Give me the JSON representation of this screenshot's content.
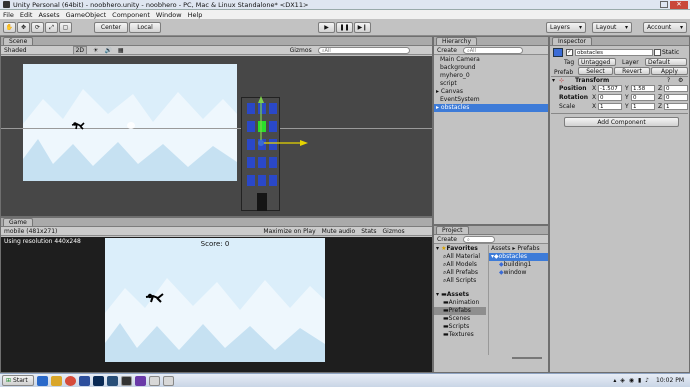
{
  "window": {
    "title": "Unity Personal (64bit) - noobhero.unity - noobhero - PC, Mac & Linux Standalone* <DX11>"
  },
  "menu": [
    "File",
    "Edit",
    "Assets",
    "GameObject",
    "Component",
    "Window",
    "Help"
  ],
  "toolbar": {
    "center": "Center",
    "local": "Local",
    "layers": "Layers",
    "layout": "Layout",
    "account": "Account"
  },
  "scene": {
    "tab": "Scene",
    "shading": "Shaded",
    "mode2d": "2D",
    "gizmos": "Gizmos",
    "search_placeholder": "All"
  },
  "game": {
    "tab": "Game",
    "resolution": "mobile (481x271)",
    "maximize": "Maximize on Play",
    "mute": "Mute audio",
    "stats": "Stats",
    "gizmos": "Gizmos",
    "using_resolution": "Using resolution 440x248",
    "score": "Score: 0"
  },
  "hierarchy": {
    "tab": "Hierarchy",
    "create": "Create",
    "search_placeholder": "All",
    "items": [
      "Main Camera",
      "background",
      "myhero_0",
      "script",
      "Canvas",
      "EventSystem",
      "obstacles"
    ]
  },
  "project": {
    "tab": "Project",
    "create": "Create",
    "favorites": "Favorites",
    "fav_items": [
      "All Material",
      "All Models",
      "All Prefabs",
      "All Scripts"
    ],
    "assets": "Assets",
    "asset_items": [
      "Animation",
      "Prefabs",
      "Scenes",
      "Scripts",
      "Textures"
    ],
    "breadcrumb": "Assets ▸ Prefabs",
    "files": [
      "obstacles",
      "building1",
      "window"
    ]
  },
  "inspector": {
    "tab": "Inspector",
    "object_name": "obstacles",
    "static": "Static",
    "tag_label": "Tag",
    "tag": "Untagged",
    "layer_label": "Layer",
    "layer": "Default",
    "prefab": "Prefab",
    "select": "Select",
    "revert": "Revert",
    "apply": "Apply",
    "transform": "Transform",
    "position": "Position",
    "rotation": "Rotation",
    "scale": "Scale",
    "pos": {
      "x": "-1.507",
      "y": "1.58",
      "z": "0"
    },
    "rot": {
      "x": "0",
      "y": "0",
      "z": "0"
    },
    "scl": {
      "x": "1",
      "y": "1",
      "z": "1"
    },
    "add_component": "Add Component"
  },
  "taskbar": {
    "start": "Start",
    "time": "10:02 PM"
  },
  "colors": {
    "selection": "#3d7bd8",
    "sky": "#dbeefa",
    "building": "#4a4a4a",
    "window": "#2a48c8"
  }
}
